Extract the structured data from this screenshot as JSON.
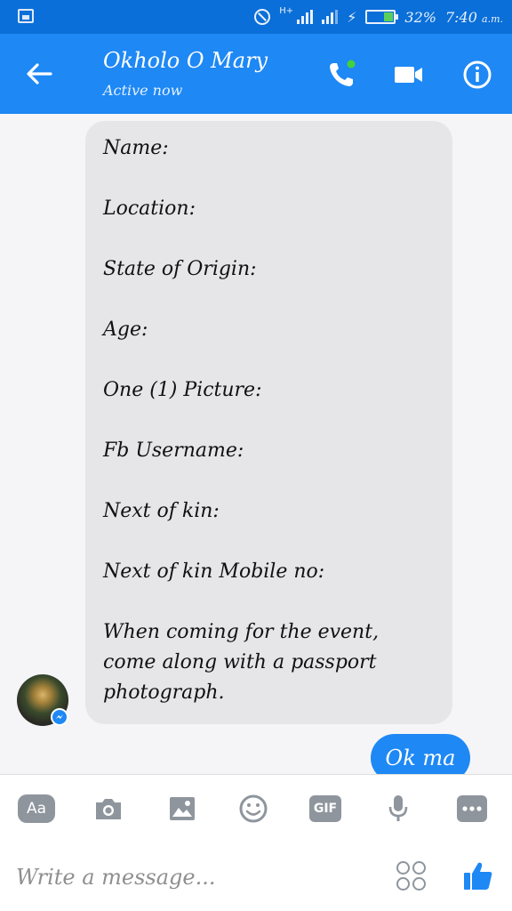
{
  "status_bar": {
    "network_label": "H+",
    "battery_percent": "32%",
    "time": "7:40",
    "time_suffix": "a.m."
  },
  "header": {
    "contact_name": "Okholo O Mary",
    "status": "Active now"
  },
  "messages": {
    "incoming": {
      "lines": [
        "Name:",
        "",
        "Location:",
        "",
        "State of Origin:",
        "",
        "Age:",
        "",
        "One (1) Picture:",
        "",
        "Fb Username:",
        "",
        "Next of kin:",
        "",
        "Next of kin Mobile no:",
        "",
        "When coming for the event, come along with a passport photograph."
      ]
    },
    "outgoing": {
      "text": "Ok ma"
    }
  },
  "toolbar": {
    "aa_label": "Aa",
    "gif_label": "GIF"
  },
  "composer": {
    "placeholder": "Write a message..."
  },
  "colors": {
    "header_blue": "#1e88f5",
    "status_bar_blue": "#0a6fd8",
    "incoming_bubble": "#e6e6e8",
    "online_dot": "#44d13a"
  }
}
